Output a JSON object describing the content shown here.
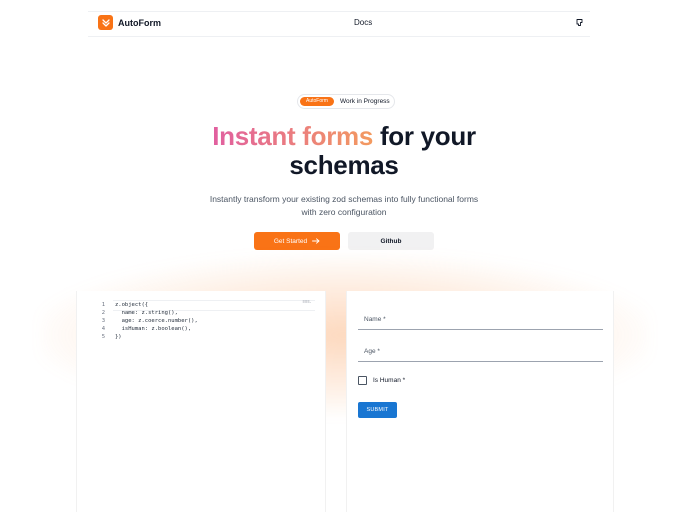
{
  "header": {
    "brand": "AutoForm",
    "nav_docs": "Docs",
    "icon": "github-icon"
  },
  "hero": {
    "badge_pill": "AutoForm",
    "badge_text": "Work in Progress",
    "headline_gradient": "Instant forms",
    "headline_rest_1": " for your",
    "headline_line2": "schemas",
    "subtitle_line1": "Instantly transform your existing zod schemas into fully functional forms",
    "subtitle_line2": "with zero configuration",
    "primary_button": "Get Started",
    "secondary_button": "Github"
  },
  "editor": {
    "lines": [
      {
        "n": "1",
        "code": "z.object({"
      },
      {
        "n": "2",
        "code": "  name: z.string(),"
      },
      {
        "n": "3",
        "code": "  age: z.coerce.number(),"
      },
      {
        "n": "4",
        "code": "  isHuman: z.boolean(),"
      },
      {
        "n": "5",
        "code": "})"
      }
    ]
  },
  "form": {
    "name_label": "Name *",
    "age_label": "Age *",
    "checkbox_label": "Is Human *",
    "submit_label": "SUBMIT"
  },
  "colors": {
    "accent": "#f97316",
    "submit": "#1976d2"
  }
}
